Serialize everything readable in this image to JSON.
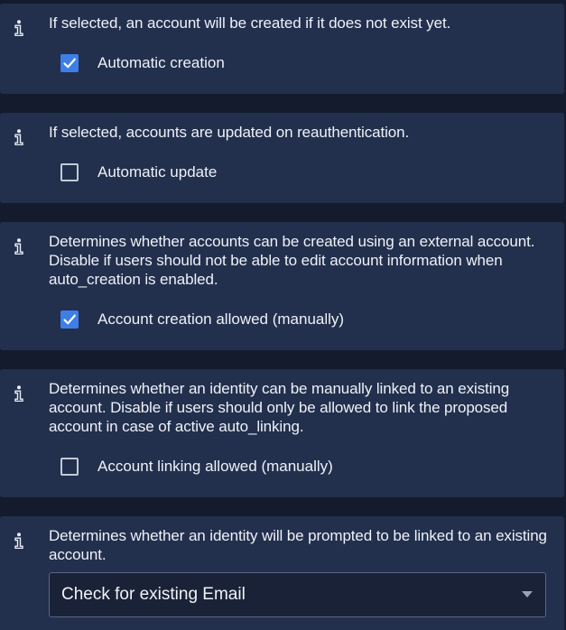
{
  "settings": [
    {
      "description": "If selected, an account will be created if it does not exist yet.",
      "control": "checkbox",
      "checked": true,
      "label": "Automatic creation"
    },
    {
      "description": "If selected, accounts are updated on reauthentication.",
      "control": "checkbox",
      "checked": false,
      "label": "Automatic update"
    },
    {
      "description": "Determines whether accounts can be created using an external account. Disable if users should not be able to edit account information when auto_creation is enabled.",
      "control": "checkbox",
      "checked": true,
      "label": "Account creation allowed (manually)"
    },
    {
      "description": "Determines whether an identity can be manually linked to an existing account. Disable if users should only be allowed to link the proposed account in case of active auto_linking.",
      "control": "checkbox",
      "checked": false,
      "label": "Account linking allowed (manually)"
    },
    {
      "description": "Determines whether an identity will be prompted to be linked to an existing account.",
      "control": "select",
      "selected": "Check for existing Email"
    }
  ],
  "icons": {
    "info": "info-icon",
    "check": "checkmark-icon",
    "dropdown": "chevron-down-icon"
  },
  "colors": {
    "background": "#141b2c",
    "panel": "#22304d",
    "checkbox_checked": "#3d7fe6",
    "text": "#eef1f7"
  }
}
